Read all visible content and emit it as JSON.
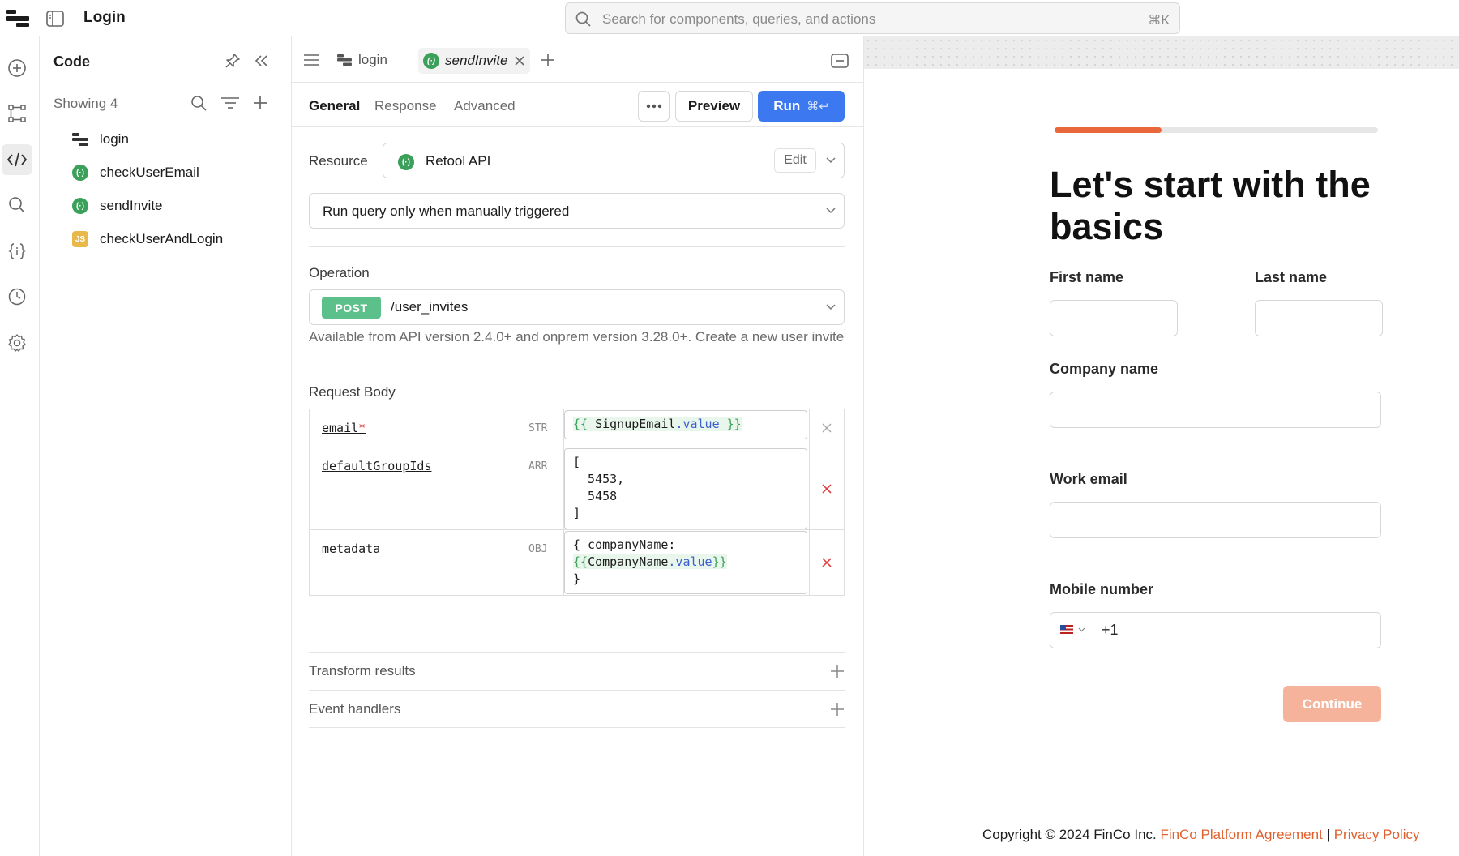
{
  "app": {
    "title": "Login"
  },
  "search": {
    "placeholder": "Search for components, queries, and actions",
    "shortcut": "⌘K"
  },
  "code_panel": {
    "title": "Code",
    "showing": "Showing 4",
    "items": [
      {
        "label": "login",
        "icon": "page-icon"
      },
      {
        "label": "checkUserEmail",
        "icon": "resource-query-icon"
      },
      {
        "label": "sendInvite",
        "icon": "resource-query-icon"
      },
      {
        "label": "checkUserAndLogin",
        "icon": "js-query-icon",
        "icon_text": "JS"
      }
    ]
  },
  "editor": {
    "tabs": [
      {
        "label": "login"
      },
      {
        "label": "sendInvite"
      }
    ],
    "subtabs": {
      "general": "General",
      "response": "Response",
      "advanced": "Advanced"
    },
    "preview_label": "Preview",
    "run_label": "Run",
    "run_shortcut": "⌘↩",
    "resource_label": "Resource",
    "resource_value": "Retool API",
    "edit_label": "Edit",
    "trigger_value": "Run query only when manually triggered",
    "operation_label": "Operation",
    "method": "POST",
    "path": "/user_invites",
    "operation_desc": "Available from API version 2.4.0+ and onprem version 3.28.0+. Create a new user invite",
    "request_body_label": "Request Body",
    "body": [
      {
        "key": "email",
        "required": true,
        "type": "STR"
      },
      {
        "key": "defaultGroupIds",
        "required": false,
        "type": "ARR"
      },
      {
        "key": "metadata",
        "required": false,
        "type": "OBJ"
      }
    ],
    "transform_label": "Transform results",
    "events_label": "Event handlers"
  },
  "preview": {
    "progress": 0.33,
    "heading": "Let's start with the basics",
    "first_name_label": "First name",
    "last_name_label": "Last name",
    "company_label": "Company name",
    "email_label": "Work email",
    "mobile_label": "Mobile number",
    "phone_code": "+1",
    "continue_label": "Continue",
    "footer_text": "Copyright © 2024 FinCo Inc.",
    "footer_link1": "FinCo Platform Agreement",
    "footer_sep": "|",
    "footer_link2": "Privacy Policy"
  },
  "colors": {
    "accent": "#3c78f0",
    "brand": "#e8683c",
    "query_green": "#3aa05a"
  }
}
